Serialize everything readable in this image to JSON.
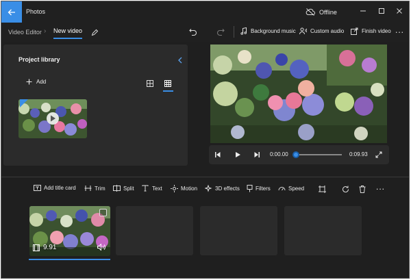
{
  "window": {
    "app_title": "Photos",
    "status": "Offline"
  },
  "breadcrumb": {
    "parent": "Video Editor",
    "current": "New video"
  },
  "toolbar": {
    "background_music": "Background music",
    "custom_audio": "Custom audio",
    "finish_video": "Finish video"
  },
  "library": {
    "title": "Project library",
    "add_label": "Add"
  },
  "player": {
    "current_time": "0:00.00",
    "total_time": "0:09.93",
    "progress": 0
  },
  "storyboard_toolbar": {
    "add_title_card": "Add title card",
    "trim": "Trim",
    "split": "Split",
    "text": "Text",
    "motion": "Motion",
    "effects_3d": "3D effects",
    "filters": "Filters",
    "speed": "Speed"
  },
  "storyboard": {
    "clip_duration": "9.91"
  },
  "colors": {
    "accent": "#3a8ee6",
    "panel": "#2b2b2b",
    "background": "#1f1f1f"
  }
}
